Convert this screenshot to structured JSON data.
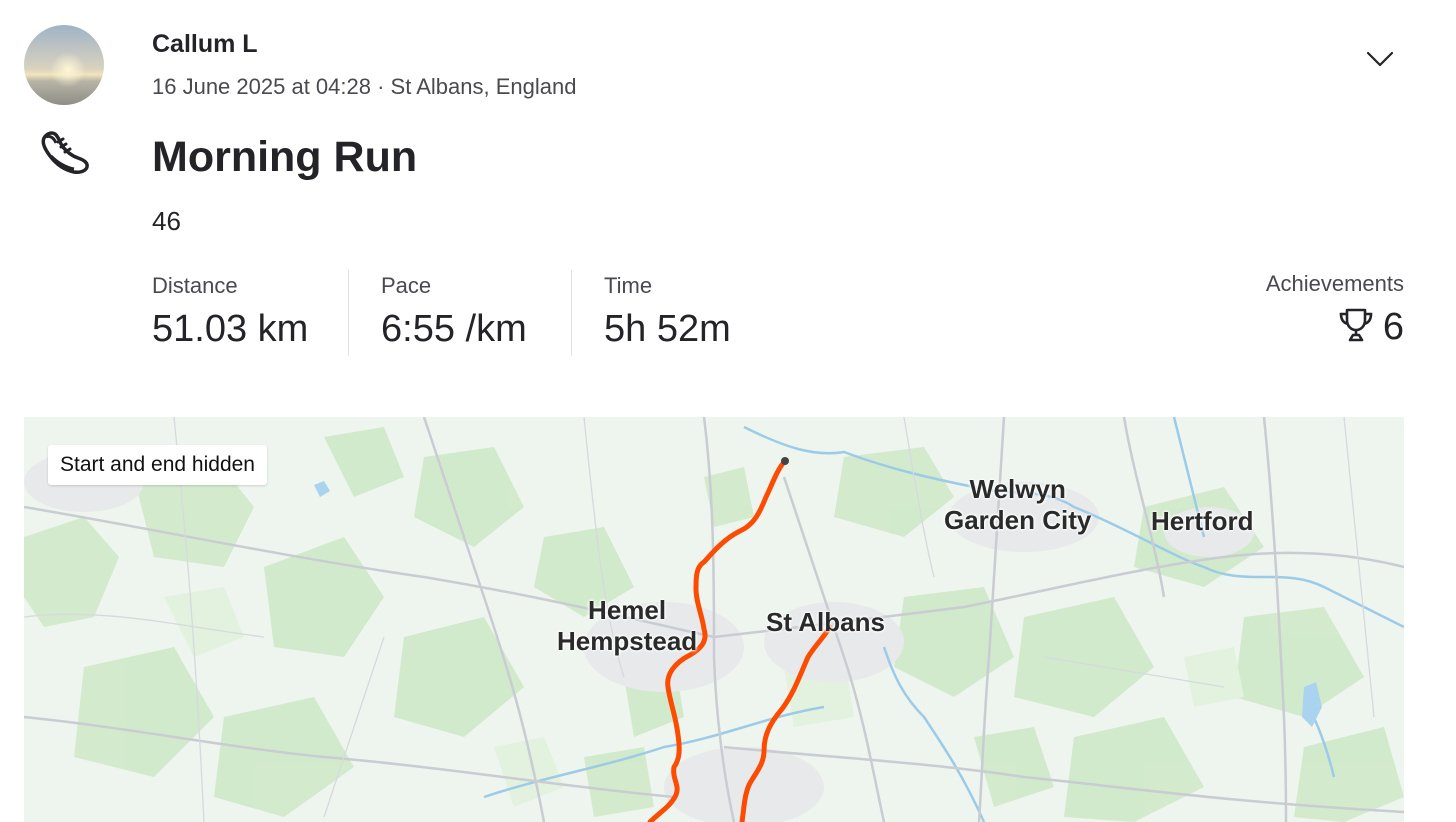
{
  "athlete": {
    "name": "Callum L",
    "meta": "16 June 2025 at 04:28 · St Albans, England"
  },
  "header": {
    "menu_icon": "chevron-down-icon",
    "sport_icon": "running-shoe-icon"
  },
  "activity": {
    "title": "Morning Run",
    "description": "46"
  },
  "stats": [
    {
      "label": "Distance",
      "value": "51.03 km"
    },
    {
      "label": "Pace",
      "value": "6:55 /km"
    },
    {
      "label": "Time",
      "value": "5h 52m"
    }
  ],
  "achievements": {
    "label": "Achievements",
    "icon": "trophy-icon",
    "count": "6"
  },
  "map": {
    "privacy_badge": "Start and end hidden",
    "route_color": "#fc4c02",
    "places": {
      "welwyn": "Welwyn\nGarden City",
      "hertford": "Hertford",
      "hemel": "Hemel\nHempstead",
      "st_albans": "St Albans"
    }
  },
  "colors": {
    "text": "#242428",
    "muted": "#494950",
    "accent": "#fc4c02"
  }
}
